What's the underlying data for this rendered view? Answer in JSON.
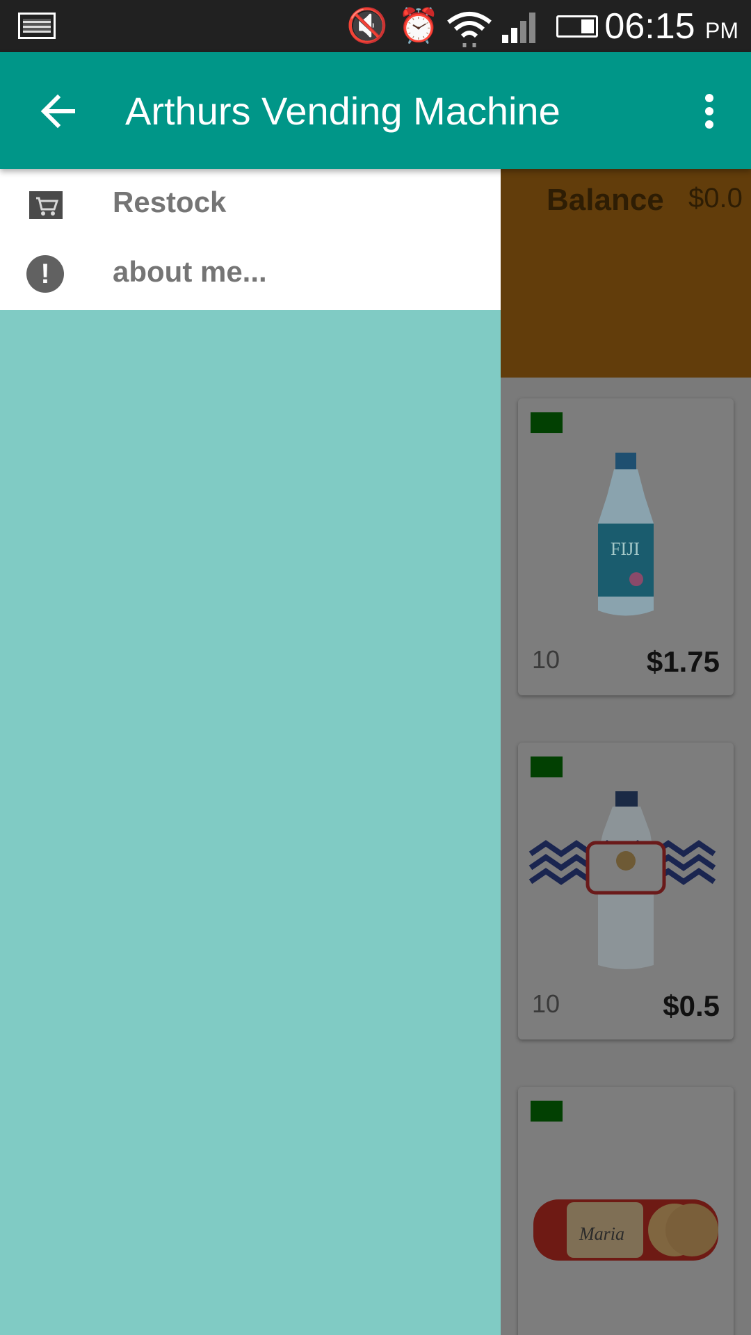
{
  "status_bar": {
    "time": "06:15",
    "ampm": "PM",
    "icons": [
      "gallery-icon",
      "mute-icon",
      "alarm-icon",
      "wifi-icon",
      "signal-icon",
      "battery-icon"
    ]
  },
  "toolbar": {
    "title": "Arthurs Vending Machine",
    "back_icon": "arrow-left-icon",
    "menu_icon": "more-vert-icon",
    "color": "#009688"
  },
  "drawer": {
    "background": "#80cbc4",
    "items": [
      {
        "label": "Restock",
        "icon": "cart-icon"
      },
      {
        "label": "about me...",
        "icon": "info-icon"
      }
    ]
  },
  "balance": {
    "label": "Balance",
    "value": "$0.0"
  },
  "products": [
    {
      "qty": "10",
      "price": "$1.75",
      "image": "fiji-water-bottle"
    },
    {
      "qty": "10",
      "price": "$0.5",
      "image": "chevron-label-water-bottle"
    },
    {
      "qty": "",
      "price": "",
      "image": "maria-cookies-pack"
    }
  ]
}
